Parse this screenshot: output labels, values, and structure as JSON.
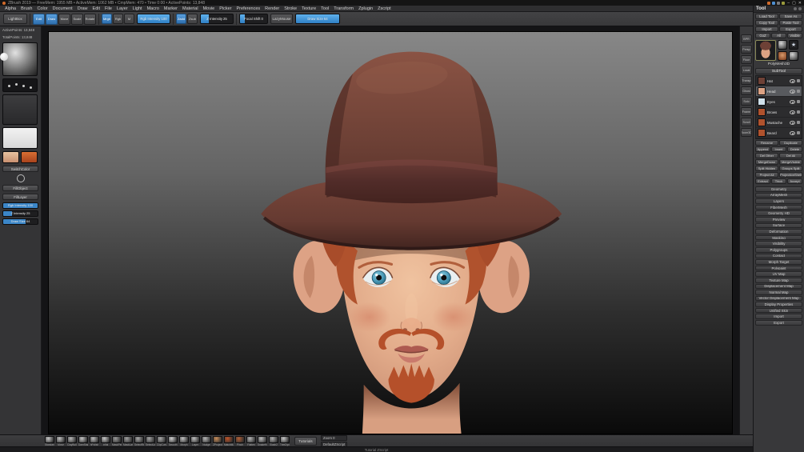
{
  "titlebar": {
    "title": "ZBrush 2019  —  FreeMem: 1955 MB  •  ActiveMem: 1062 MB  •  CmpMem: 470  •  Time 0:00  •  ActivePoints: 13,848",
    "window_controls": {
      "minimize": "–",
      "maximize": "▢",
      "close": "✕"
    }
  },
  "menubar": {
    "items": [
      "Alpha",
      "Brush",
      "Color",
      "Document",
      "Draw",
      "Edit",
      "File",
      "Layer",
      "Light",
      "Macro",
      "Marker",
      "Material",
      "Movie",
      "Picker",
      "Preferences",
      "Render",
      "Stroke",
      "Texture",
      "Tool",
      "Transform",
      "Zplugin",
      "Zscript"
    ]
  },
  "top_shelf": {
    "lightbox": "LightBox",
    "mode_buttons": [
      {
        "label": "Edit",
        "active": true
      },
      {
        "label": "Draw",
        "active": true
      },
      {
        "label": "Move",
        "active": false
      },
      {
        "label": "Scale",
        "active": false
      },
      {
        "label": "Rotate",
        "active": false
      }
    ],
    "paint_modes": [
      {
        "label": "Mrgb",
        "active": true
      },
      {
        "label": "Rgb",
        "active": false
      },
      {
        "label": "M",
        "active": false
      }
    ],
    "rgb_intensity": {
      "label": "Rgb Intensity",
      "value": "100",
      "pct": 100
    },
    "sculpt_modes": [
      {
        "label": "Zadd",
        "active": true
      },
      {
        "label": "Zsub",
        "active": false
      }
    ],
    "z_intensity": {
      "label": "Z Intensity",
      "value": "25",
      "pct": 25
    },
    "focal_shift": {
      "label": "Focal Shift",
      "value": "0",
      "pct": 18
    },
    "lazymouse": "LazyMouse",
    "draw_size": {
      "label": "Draw Size",
      "value": "64",
      "pct": 100
    }
  },
  "left_shelf": {
    "stats": [
      "ActivePoints: 13,848",
      "TotalPoints: 13,848"
    ],
    "switch_color": "SwitchColor",
    "buttons": [
      "FillObject",
      "FillLayer"
    ],
    "sliders": [
      {
        "label": "Rgb Intensity",
        "value": "100",
        "pct": 100
      },
      {
        "label": "Z Intensity",
        "value": "25",
        "pct": 25
      },
      {
        "label": "Draw Size",
        "value": "64",
        "pct": 64
      }
    ]
  },
  "right_shelf": {
    "icons": [
      "BPR",
      "Persp",
      "Floor",
      "Local",
      "Transp",
      "Ghost",
      "Solo",
      "Frame",
      "Scroll",
      "Zoom3D"
    ]
  },
  "tool_palette": {
    "header": "Tool",
    "button_rows": [
      [
        "Load Tool",
        "Save As"
      ],
      [
        "Copy Tool",
        "Paste Tool"
      ],
      [
        "Import",
        "Export"
      ],
      [
        "GoZ",
        "All",
        "Visible"
      ]
    ],
    "active_tool": "PolyMesh3D",
    "subtool": {
      "header": "SubTool",
      "items": [
        {
          "name": "Hat",
          "color": "#6e4136",
          "selected": false
        },
        {
          "name": "Head",
          "color": "#dca284",
          "selected": true
        },
        {
          "name": "Eyes",
          "color": "#cfe0ea",
          "selected": false
        },
        {
          "name": "Brows",
          "color": "#b0522d",
          "selected": false
        },
        {
          "name": "Mustache",
          "color": "#b0522d",
          "selected": false
        },
        {
          "name": "Beard",
          "color": "#b0522d",
          "selected": false
        }
      ],
      "button_rows": [
        [
          "Rename",
          "Duplicate"
        ],
        [
          "Append",
          "Insert",
          "Delete"
        ],
        [
          "Del Other",
          "Del All"
        ],
        [
          "MergeDown",
          "MergeVisible"
        ],
        [
          "Split Hidden",
          "Groups Split"
        ],
        [
          "Project All",
          "ProjectionShell"
        ],
        [
          "Extract",
          "Thick",
          "Accept"
        ]
      ]
    },
    "sections": [
      "Geometry",
      "ArrayMesh",
      "Layers",
      "FiberMesh",
      "Geometry HD",
      "Preview",
      "Surface",
      "Deformation",
      "Masking",
      "Visibility",
      "Polygroups",
      "Contact",
      "Morph Target",
      "Polypaint",
      "UV Map",
      "Texture Map",
      "Displacement Map",
      "Normal Map",
      "Vector Displacement Map",
      "Display Properties",
      "Unified Skin",
      "Import",
      "Export"
    ]
  },
  "bottom_shelf": {
    "brushes": [
      {
        "name": "Standard",
        "tint": "#c8c8c8"
      },
      {
        "name": "Move",
        "tint": "#c0c0c0"
      },
      {
        "name": "ClayBuildup",
        "tint": "#b8b8b8"
      },
      {
        "name": "DamStandard",
        "tint": "#c4c4c4"
      },
      {
        "name": "hPolish",
        "tint": "#bcbcbc"
      },
      {
        "name": "Inflat",
        "tint": "#c6c6c6"
      },
      {
        "name": "MaskPen",
        "tint": "#9a9a9a"
      },
      {
        "name": "MaskLasso",
        "tint": "#9f9f9f"
      },
      {
        "name": "SelectRect",
        "tint": "#a8a8a8"
      },
      {
        "name": "SelectLasso",
        "tint": "#a4a4a4"
      },
      {
        "name": "ClipCurve",
        "tint": "#aaaaaa"
      },
      {
        "name": "Smooth",
        "tint": "#d0d0d0"
      },
      {
        "name": "Morph",
        "tint": "#c2c2c2"
      },
      {
        "name": "Layer",
        "tint": "#bebebe"
      },
      {
        "name": "Nudge",
        "tint": "#b6b6b6"
      },
      {
        "name": "ZProject",
        "tint": "#c98d5a"
      },
      {
        "name": "MatchMaker",
        "tint": "#c0552a"
      },
      {
        "name": "Pinch",
        "tint": "#b06038"
      },
      {
        "name": "Flatten",
        "tint": "#b4b4b4"
      },
      {
        "name": "SnakeHook",
        "tint": "#bcbcbc"
      },
      {
        "name": "Slash2",
        "tint": "#b0b0b0"
      },
      {
        "name": "TrimDynamic",
        "tint": "#c6c6c6"
      }
    ],
    "tutorials": "Tutorials",
    "info_lines": [
      "Zoom 0",
      "DefaultZScript"
    ]
  },
  "status_bar": {
    "text": "Tutorial ZScript"
  },
  "colors": {
    "accent": "#3b97e3",
    "hat": "#6e4136",
    "hair": "#b0522d",
    "skin": "#dca284",
    "iris": "#4d9cba"
  }
}
